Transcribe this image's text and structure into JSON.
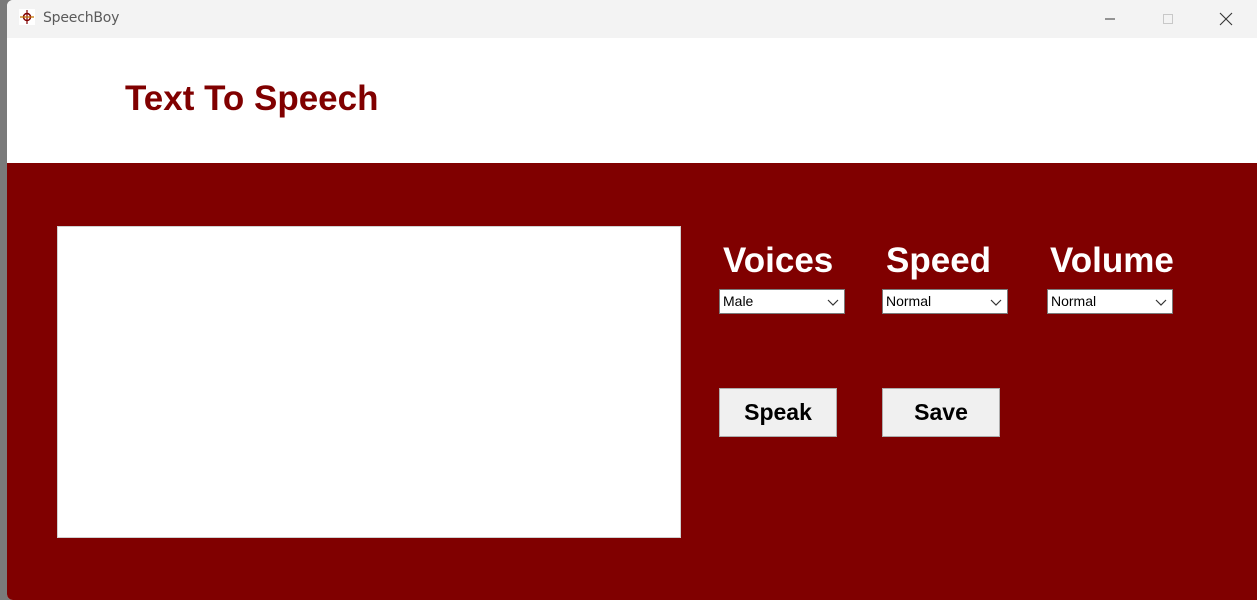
{
  "window": {
    "title": "SpeechBoy",
    "icon": "app-icon"
  },
  "header": {
    "title": "Text To Speech"
  },
  "main": {
    "text_input": {
      "value": ""
    },
    "voices": {
      "label": "Voices",
      "selected": "Male"
    },
    "speed": {
      "label": "Speed",
      "selected": "Normal"
    },
    "volume": {
      "label": "Volume",
      "selected": "Normal"
    },
    "buttons": {
      "speak": "Speak",
      "save": "Save"
    }
  },
  "colors": {
    "accent": "#800000",
    "title_text": "#800000",
    "label_text": "#ffffff"
  }
}
